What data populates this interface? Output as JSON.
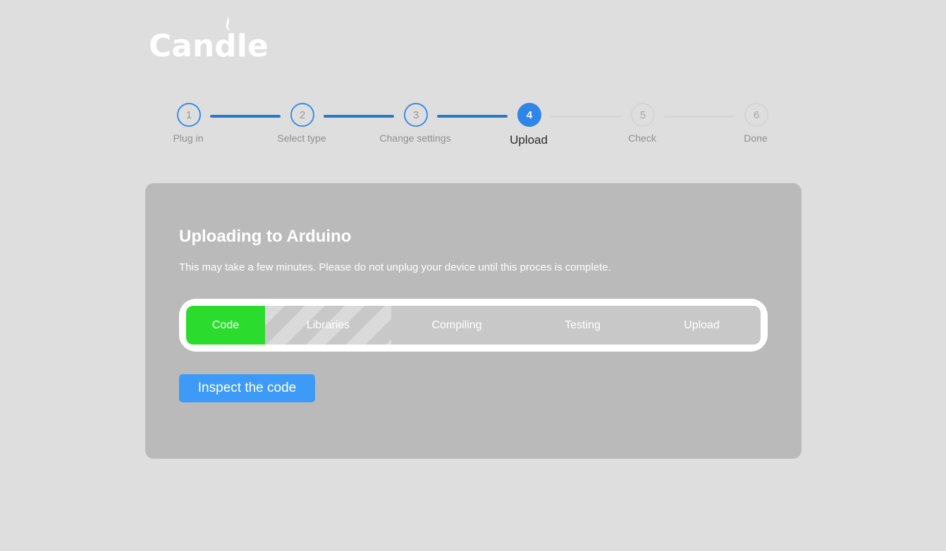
{
  "brand": {
    "name": "Candle"
  },
  "stepper": {
    "steps": [
      {
        "number": "1",
        "label": "Plug in",
        "state": "completed"
      },
      {
        "number": "2",
        "label": "Select type",
        "state": "completed"
      },
      {
        "number": "3",
        "label": "Change settings",
        "state": "completed"
      },
      {
        "number": "4",
        "label": "Upload",
        "state": "active"
      },
      {
        "number": "5",
        "label": "Check",
        "state": "future"
      },
      {
        "number": "6",
        "label": "Done",
        "state": "future"
      }
    ]
  },
  "card": {
    "title": "Uploading to Arduino",
    "description": "This may take a few minutes. Please do not unplug your device until this proces is complete.",
    "pipeline": {
      "stages": [
        {
          "label": "Code",
          "state": "done"
        },
        {
          "label": "Libraries",
          "state": "in-progress"
        },
        {
          "label": "Compiling",
          "state": "pending"
        },
        {
          "label": "Testing",
          "state": "pending"
        },
        {
          "label": "Upload",
          "state": "pending"
        }
      ]
    },
    "inspect_button": "Inspect the code"
  },
  "colors": {
    "background": "#dedede",
    "accent": "#2f86e8",
    "stage_done": "#2bdc2e",
    "card": "#bababa",
    "button": "#3d9bf7"
  }
}
